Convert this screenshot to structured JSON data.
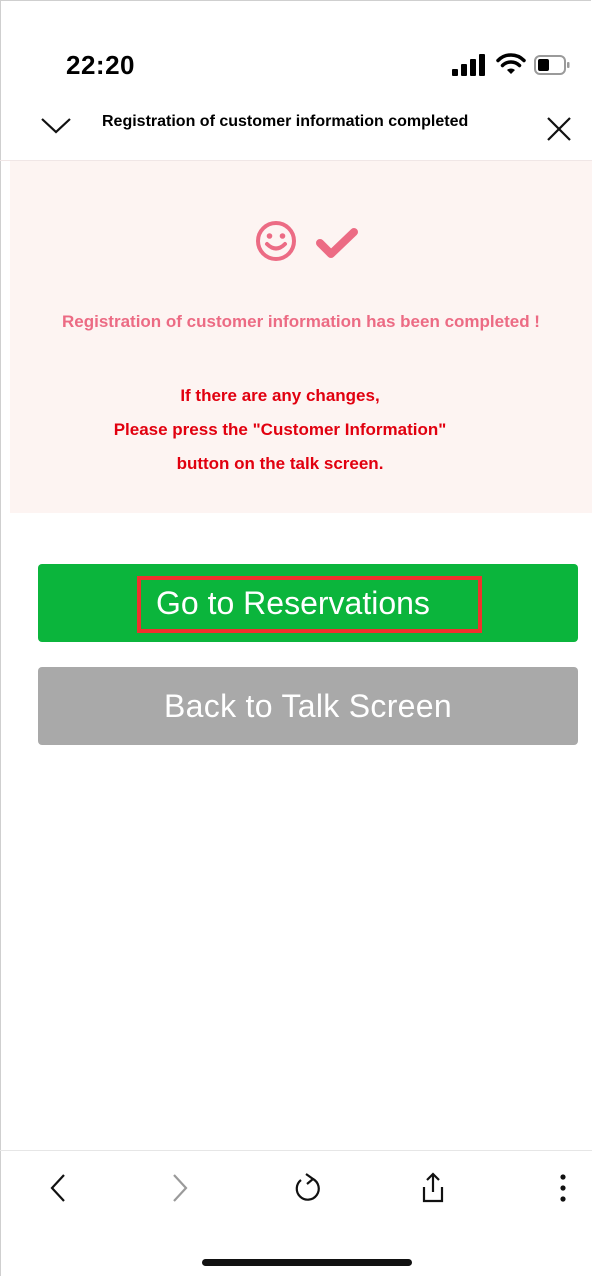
{
  "status_bar": {
    "time": "22:20"
  },
  "header": {
    "title": "Registration of customer information completed"
  },
  "panel": {
    "completed_message": "Registration of customer information has been completed !",
    "note_lines": [
      "If there are any changes,",
      "Please press the \"Customer Information\"",
      "button on the talk screen."
    ]
  },
  "buttons": {
    "reservations": "Go to Reservations",
    "back": "Back to Talk Screen"
  },
  "colors": {
    "accent_green": "#0bb53c",
    "pink": "#ec6b84",
    "note_red": "#e1000f",
    "highlight_red": "#f0312d",
    "gray_button": "#a9a9a9"
  },
  "icons": {
    "header_left": "chevron-down-icon",
    "header_right": "close-icon",
    "panel": [
      "smiley-icon",
      "check-icon"
    ],
    "toolbar": [
      "back-arrow-icon",
      "forward-arrow-icon",
      "reload-icon",
      "share-icon",
      "more-icon"
    ]
  }
}
